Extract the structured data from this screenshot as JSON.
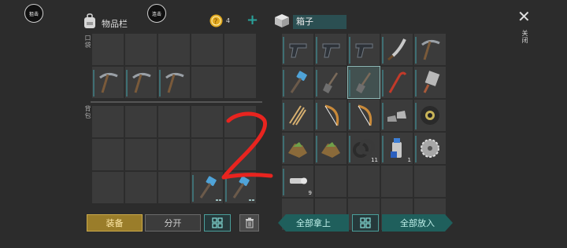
{
  "left_panel": {
    "btn_snipe_label": "狙击",
    "btn_burst_label": "连击",
    "bag_title": "物品栏",
    "coin_count": "4",
    "plus_label": "+",
    "pocket_label": "口袋",
    "backpack_label": "背包"
  },
  "right_panel": {
    "box_title": "箱子",
    "close_label": "关闭"
  },
  "box_counts": {
    "tires": "11",
    "spray": "1",
    "pipe": "9"
  },
  "bottom": {
    "equip_label": "装备",
    "split_label": "分开",
    "take_all_label": "全部拿上",
    "put_all_label": "全部放入"
  },
  "icons": {
    "pocket": [
      "empty",
      "empty",
      "empty",
      "empty",
      "empty",
      "pickaxe",
      "pickaxe",
      "pickaxe",
      "empty",
      "empty"
    ],
    "backpack": [
      "empty",
      "empty",
      "empty",
      "empty",
      "empty",
      "empty",
      "empty",
      "empty",
      "empty",
      "empty",
      "empty",
      "empty",
      "empty",
      "hammer",
      "hammer"
    ],
    "box": [
      "pistol",
      "pistol",
      "pistol",
      "machete",
      "pickaxe",
      "hammer",
      "shovel",
      "shovel",
      "crowbar",
      "cleaver",
      "arrows",
      "bow",
      "bow",
      "boots",
      "tire-roll",
      "ore",
      "ore",
      "tires",
      "spray-can",
      "saw-blade",
      "pipe",
      "empty",
      "empty",
      "empty",
      "empty",
      "empty",
      "empty",
      "empty",
      "empty",
      "empty"
    ]
  },
  "colors": {
    "accent": "#2aa19a",
    "equip": "#9a7d2a",
    "annotation": "#e8241f"
  }
}
